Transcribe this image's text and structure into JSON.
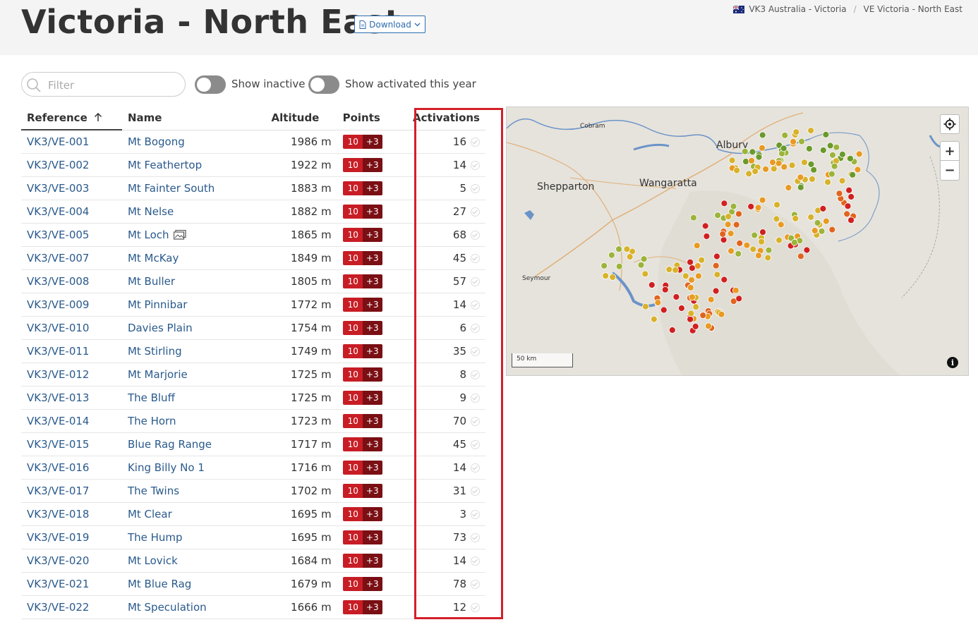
{
  "header": {
    "title": "Victoria - North East",
    "download_label": "Download",
    "breadcrumb": [
      "VK3 Australia - Victoria",
      "VE Victoria - North East"
    ]
  },
  "filters": {
    "filter_placeholder": "Filter",
    "show_inactive_label": "Show inactive",
    "show_activated_label": "Show activated this year"
  },
  "table": {
    "headers": {
      "reference": "Reference",
      "name": "Name",
      "altitude": "Altitude",
      "points": "Points",
      "activations": "Activations"
    },
    "rows": [
      {
        "ref": "VK3/VE-001",
        "name": "Mt Bogong",
        "alt": "1986 m",
        "pts": "10",
        "bonus": "+3",
        "acts": "16"
      },
      {
        "ref": "VK3/VE-002",
        "name": "Mt Feathertop",
        "alt": "1922 m",
        "pts": "10",
        "bonus": "+3",
        "acts": "14"
      },
      {
        "ref": "VK3/VE-003",
        "name": "Mt Fainter South",
        "alt": "1883 m",
        "pts": "10",
        "bonus": "+3",
        "acts": "5"
      },
      {
        "ref": "VK3/VE-004",
        "name": "Mt Nelse",
        "alt": "1882 m",
        "pts": "10",
        "bonus": "+3",
        "acts": "27"
      },
      {
        "ref": "VK3/VE-005",
        "name": "Mt Loch",
        "alt": "1865 m",
        "pts": "10",
        "bonus": "+3",
        "acts": "68",
        "photo": true
      },
      {
        "ref": "VK3/VE-007",
        "name": "Mt McKay",
        "alt": "1849 m",
        "pts": "10",
        "bonus": "+3",
        "acts": "45"
      },
      {
        "ref": "VK3/VE-008",
        "name": "Mt Buller",
        "alt": "1805 m",
        "pts": "10",
        "bonus": "+3",
        "acts": "57"
      },
      {
        "ref": "VK3/VE-009",
        "name": "Mt Pinnibar",
        "alt": "1772 m",
        "pts": "10",
        "bonus": "+3",
        "acts": "14"
      },
      {
        "ref": "VK3/VE-010",
        "name": "Davies Plain",
        "alt": "1754 m",
        "pts": "10",
        "bonus": "+3",
        "acts": "6"
      },
      {
        "ref": "VK3/VE-011",
        "name": "Mt Stirling",
        "alt": "1749 m",
        "pts": "10",
        "bonus": "+3",
        "acts": "35"
      },
      {
        "ref": "VK3/VE-012",
        "name": "Mt Marjorie",
        "alt": "1725 m",
        "pts": "10",
        "bonus": "+3",
        "acts": "8"
      },
      {
        "ref": "VK3/VE-013",
        "name": "The Bluff",
        "alt": "1725 m",
        "pts": "10",
        "bonus": "+3",
        "acts": "9"
      },
      {
        "ref": "VK3/VE-014",
        "name": "The Horn",
        "alt": "1723 m",
        "pts": "10",
        "bonus": "+3",
        "acts": "70"
      },
      {
        "ref": "VK3/VE-015",
        "name": "Blue Rag Range",
        "alt": "1717 m",
        "pts": "10",
        "bonus": "+3",
        "acts": "45"
      },
      {
        "ref": "VK3/VE-016",
        "name": "King Billy No 1",
        "alt": "1716 m",
        "pts": "10",
        "bonus": "+3",
        "acts": "14"
      },
      {
        "ref": "VK3/VE-017",
        "name": "The Twins",
        "alt": "1702 m",
        "pts": "10",
        "bonus": "+3",
        "acts": "31"
      },
      {
        "ref": "VK3/VE-018",
        "name": "Mt Clear",
        "alt": "1695 m",
        "pts": "10",
        "bonus": "+3",
        "acts": "3"
      },
      {
        "ref": "VK3/VE-019",
        "name": "The Hump",
        "alt": "1695 m",
        "pts": "10",
        "bonus": "+3",
        "acts": "73"
      },
      {
        "ref": "VK3/VE-020",
        "name": "Mt Lovick",
        "alt": "1684 m",
        "pts": "10",
        "bonus": "+3",
        "acts": "14"
      },
      {
        "ref": "VK3/VE-021",
        "name": "Mt Blue Rag",
        "alt": "1679 m",
        "pts": "10",
        "bonus": "+3",
        "acts": "78"
      },
      {
        "ref": "VK3/VE-022",
        "name": "Mt Speculation",
        "alt": "1666 m",
        "pts": "10",
        "bonus": "+3",
        "acts": "12"
      }
    ]
  },
  "map": {
    "labels": {
      "cobram": "Cobram",
      "albury": "Albury",
      "shepparton": "Shepparton",
      "wangaratta": "Wangaratta",
      "seymour": "Seymour"
    },
    "scale_label": "50 km",
    "zoom_in": "+",
    "zoom_out": "−",
    "info": "i",
    "marker_colors": [
      "#6a9a2a",
      "#9cb43a",
      "#d8b22a",
      "#e89a22",
      "#e0641e",
      "#d02020",
      "#3e6e1e"
    ]
  },
  "icons": {
    "download": "document-icon",
    "dropdown": "chevron-down-icon",
    "sort": "arrow-up-icon",
    "locate": "crosshair-icon",
    "photo": "photo-icon",
    "flag": "australia-flag-icon",
    "search": "search-icon"
  }
}
